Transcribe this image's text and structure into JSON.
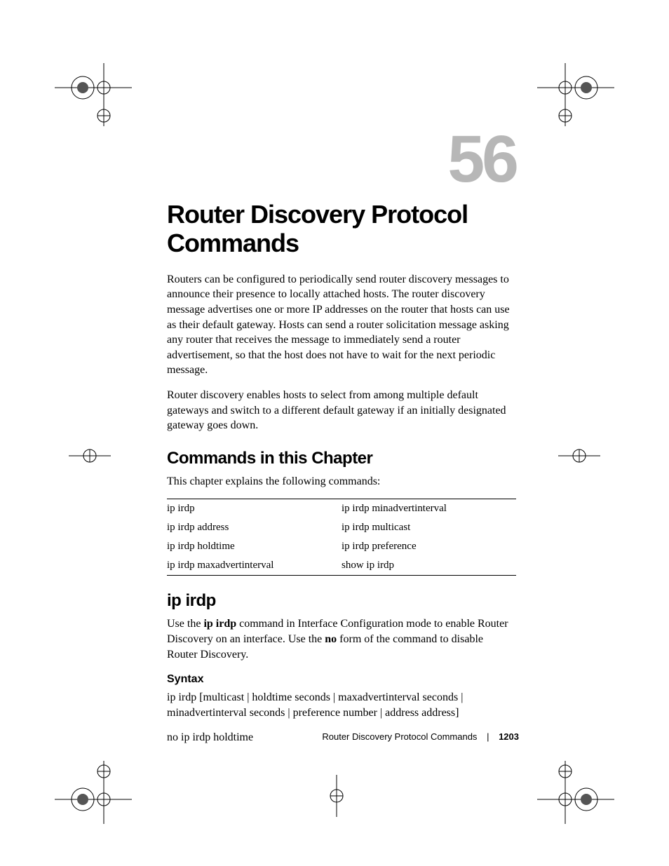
{
  "chapter": {
    "number": "56",
    "title": "Router Discovery Protocol Commands",
    "intro1": "Routers can be configured to periodically send router discovery messages to announce their presence to locally attached hosts. The router discovery message advertises one or more IP addresses on the router that hosts can use as their default gateway. Hosts can send a router solicitation message asking any router that receives the message to immediately send a router advertisement, so that the host does not have to wait for the next periodic message.",
    "intro2": "Router discovery enables hosts to select from among multiple default gateways and switch to a different default gateway if an initially designated gateway goes down."
  },
  "commands_section": {
    "heading": "Commands in this Chapter",
    "intro": "This chapter explains the following commands:",
    "rows": [
      {
        "left": "ip irdp",
        "right": "ip irdp minadvertinterval"
      },
      {
        "left": "ip irdp address",
        "right": "ip irdp multicast"
      },
      {
        "left": "ip irdp holdtime",
        "right": "ip irdp preference"
      },
      {
        "left": "ip irdp maxadvertinterval",
        "right": "show ip irdp"
      }
    ]
  },
  "ip_irdp": {
    "heading": "ip irdp",
    "p_pre": "Use the ",
    "p_bold1": "ip irdp",
    "p_mid": " command in Interface Configuration mode to enable Router Discovery on an interface. Use the ",
    "p_bold2": "no",
    "p_post": " form of the command to disable Router Discovery.",
    "syntax_heading": "Syntax",
    "syntax_line1": "ip irdp [multicast | holdtime seconds | maxadvertinterval seconds | minadvertinterval seconds | preference number | address address]",
    "syntax_line2": "no ip irdp holdtime"
  },
  "footer": {
    "title": "Router Discovery Protocol Commands",
    "page": "1203"
  }
}
